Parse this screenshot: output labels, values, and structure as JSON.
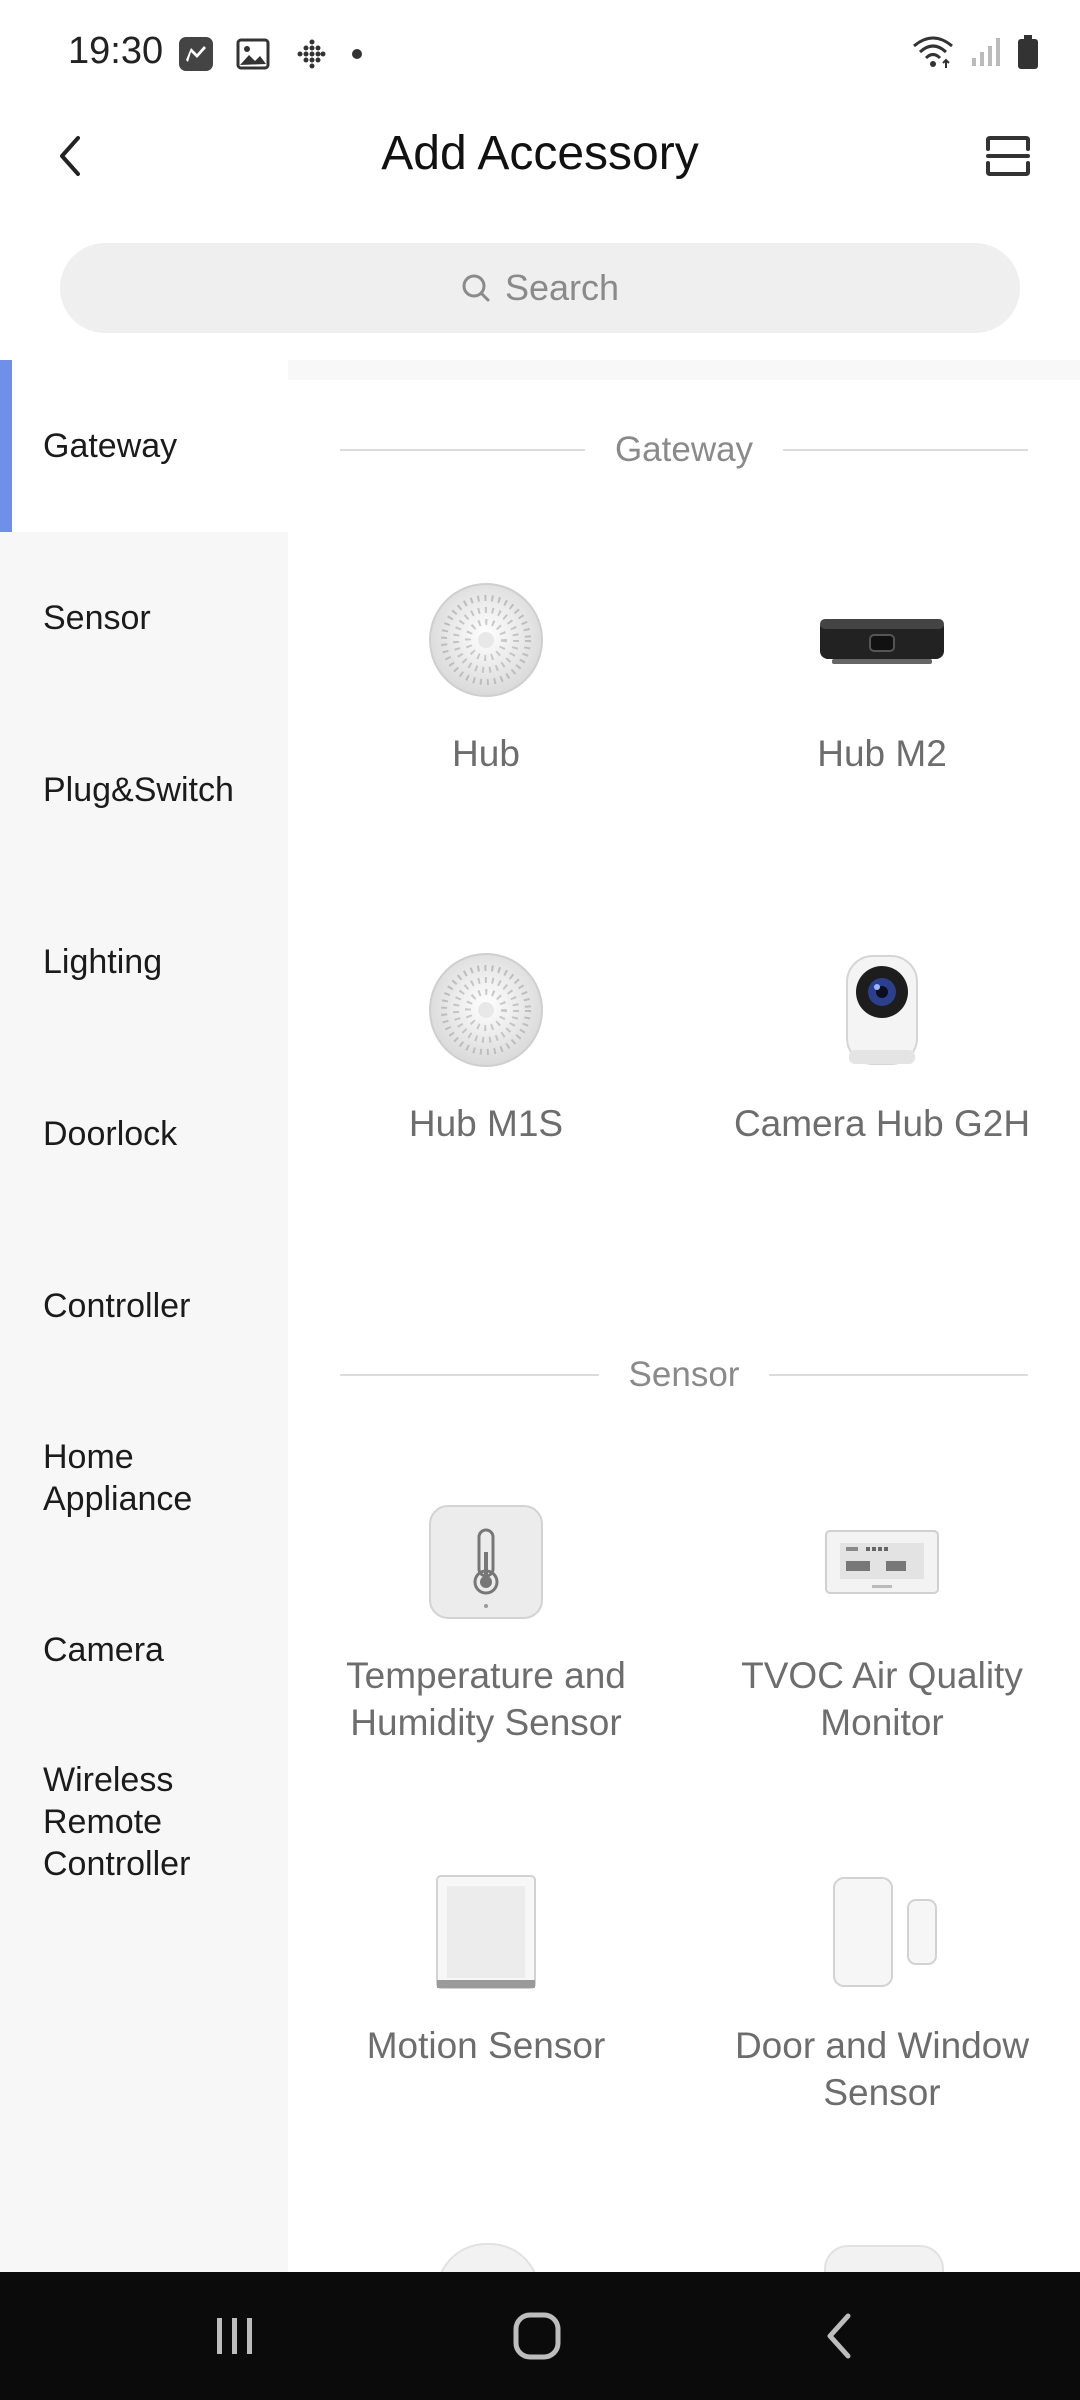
{
  "status_bar": {
    "time": "19:30",
    "left_icons": [
      "navigation-app-icon",
      "gallery-icon",
      "fitbit-icon",
      "dot-icon"
    ],
    "right_icons": [
      "wifi-icon",
      "signal-icon",
      "battery-icon"
    ]
  },
  "header": {
    "title": "Add Accessory",
    "back_icon": "chevron-left-icon",
    "scan_icon": "scan-icon"
  },
  "search": {
    "placeholder": "Search"
  },
  "sidebar": {
    "active_index": 0,
    "items": [
      {
        "label": "Gateway"
      },
      {
        "label": "Sensor"
      },
      {
        "label": "Plug&Switch"
      },
      {
        "label": "Lighting"
      },
      {
        "label": "Doorlock"
      },
      {
        "label": "Controller"
      },
      {
        "label": "Home Appliance"
      },
      {
        "label": "Camera"
      },
      {
        "label": "Wireless Remote Controller"
      }
    ]
  },
  "sections": [
    {
      "title": "Gateway",
      "items": [
        {
          "name": "Hub",
          "icon": "hub-device-icon"
        },
        {
          "name": "Hub M2",
          "icon": "hub-m2-device-icon"
        },
        {
          "name": "Hub M1S",
          "icon": "hub-m1s-device-icon"
        },
        {
          "name": "Camera Hub G2H",
          "icon": "camera-hub-device-icon"
        }
      ]
    },
    {
      "title": "Sensor",
      "items": [
        {
          "name": "Temperature and Humidity Sensor",
          "icon": "thermometer-sensor-icon"
        },
        {
          "name": "TVOC Air Quality Monitor",
          "icon": "air-quality-monitor-icon"
        },
        {
          "name": "Motion Sensor",
          "icon": "motion-sensor-icon"
        },
        {
          "name": "Door and Window Sensor",
          "icon": "door-window-sensor-icon"
        }
      ]
    }
  ],
  "nav_bar": {
    "icons": [
      "recent-apps-icon",
      "home-icon",
      "back-icon"
    ]
  },
  "colors": {
    "accent": "#6f8fe8",
    "sidebar_bg": "#f7f7f7",
    "search_bg": "#efefef",
    "item_text": "#6d6d6d",
    "section_text": "#8a8a8a",
    "nav_bar_bg": "#0b0b0b"
  }
}
